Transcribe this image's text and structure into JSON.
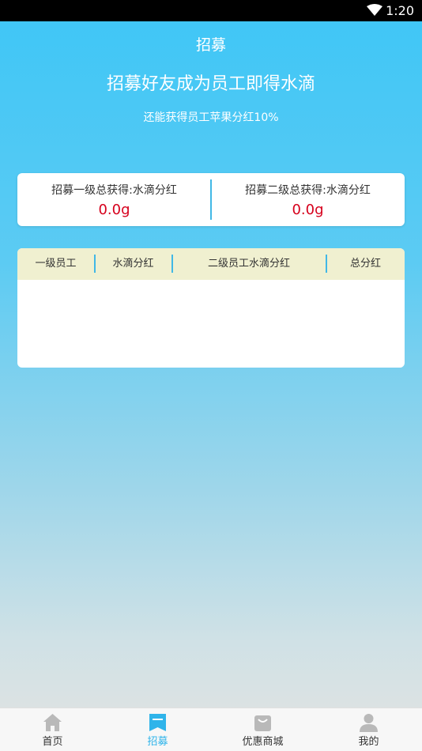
{
  "status_bar": {
    "time": "1:20"
  },
  "header": {
    "title": "招募",
    "headline": "招募好友成为员工即得水滴",
    "subline": "还能获得员工苹果分红10%"
  },
  "summary": {
    "level1_label": "招募一级总获得:水滴分红",
    "level1_value": "0.0g",
    "level2_label": "招募二级总获得:水滴分红",
    "level2_value": "0.0g"
  },
  "table": {
    "columns": [
      "一级员工",
      "水滴分红",
      "二级员工水滴分红",
      "总分红"
    ],
    "rows": []
  },
  "tabbar": {
    "items": [
      {
        "label": "首页",
        "icon": "home-icon"
      },
      {
        "label": "招募",
        "icon": "bookmark-icon"
      },
      {
        "label": "优惠商城",
        "icon": "shopping-bag-icon"
      },
      {
        "label": "我的",
        "icon": "person-icon"
      }
    ],
    "active_index": 1
  },
  "colors": {
    "accent": "#2fb4ea",
    "value_red": "#d6001c",
    "table_header_bg": "#f0f0d0"
  }
}
